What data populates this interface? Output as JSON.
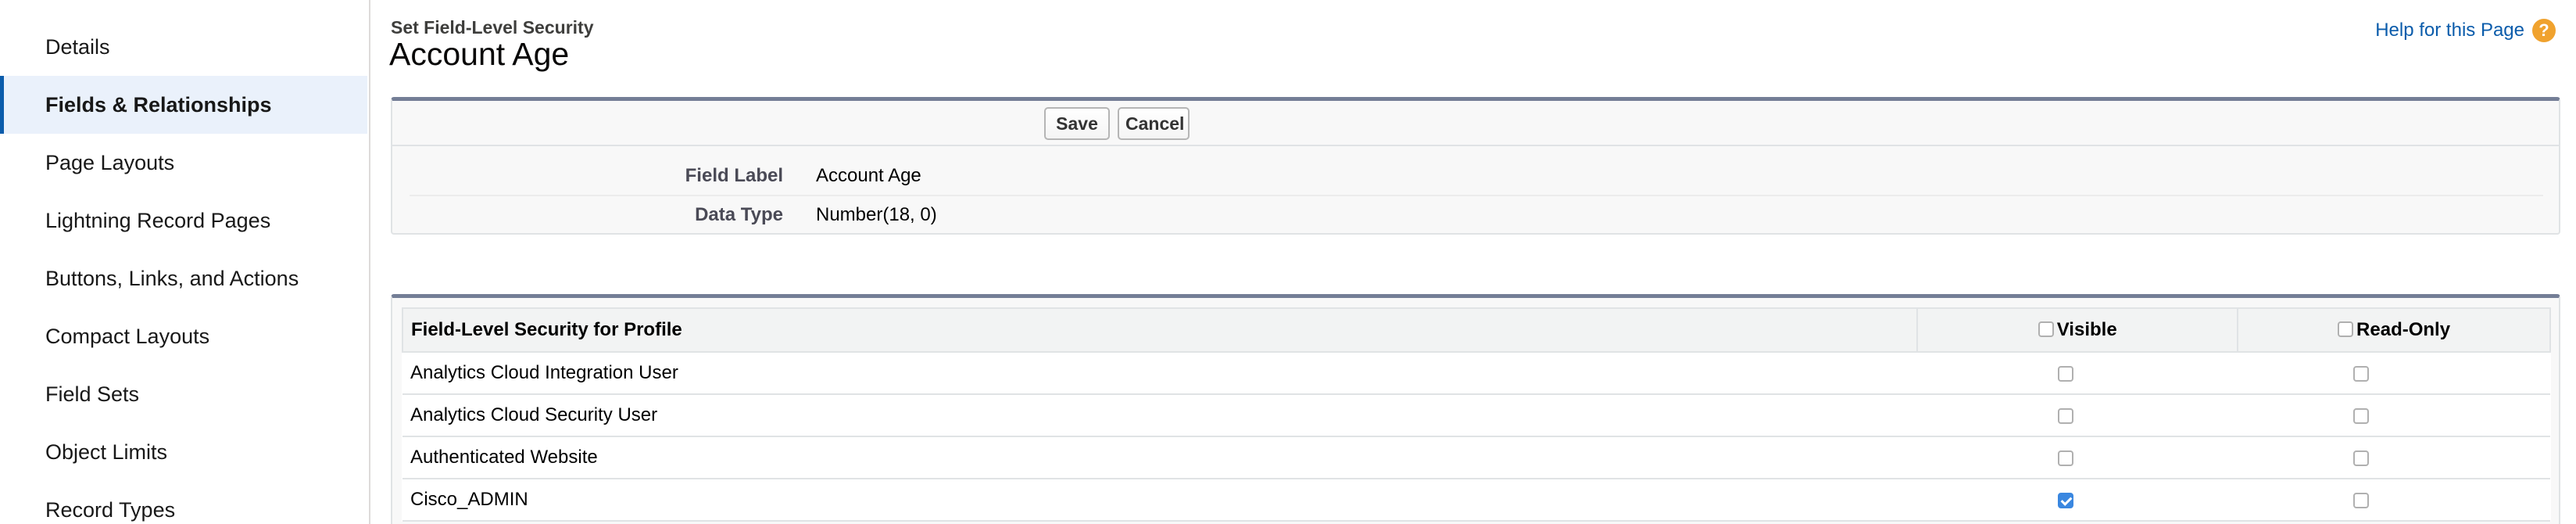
{
  "sidebar": {
    "items": [
      {
        "label": "Details",
        "active": false
      },
      {
        "label": "Fields & Relationships",
        "active": true
      },
      {
        "label": "Page Layouts",
        "active": false
      },
      {
        "label": "Lightning Record Pages",
        "active": false
      },
      {
        "label": "Buttons, Links, and Actions",
        "active": false
      },
      {
        "label": "Compact Layouts",
        "active": false
      },
      {
        "label": "Field Sets",
        "active": false
      },
      {
        "label": "Object Limits",
        "active": false
      },
      {
        "label": "Record Types",
        "active": false
      }
    ]
  },
  "header": {
    "breadcrumb": "Set Field-Level Security",
    "title": "Account Age",
    "help_link": "Help for this Page",
    "help_icon": "question-icon"
  },
  "actions": {
    "save_label": "Save",
    "cancel_label": "Cancel"
  },
  "field_info": {
    "label_caption": "Field Label",
    "label_value": "Account Age",
    "type_caption": "Data Type",
    "type_value": "Number(18, 0)"
  },
  "fls_table": {
    "columns": {
      "profile": "Field-Level Security for Profile",
      "visible": "Visible",
      "read_only": "Read-Only"
    },
    "rows": [
      {
        "profile": "Analytics Cloud Integration User",
        "visible": false,
        "read_only": false
      },
      {
        "profile": "Analytics Cloud Security User",
        "visible": false,
        "read_only": false
      },
      {
        "profile": "Authenticated Website",
        "visible": false,
        "read_only": false
      },
      {
        "profile": "Cisco_ADMIN",
        "visible": true,
        "read_only": false
      }
    ]
  },
  "colors": {
    "accent": "#0b5cab",
    "active_bg": "#eaf1fb",
    "checkbox_checked": "#3a87e0",
    "help_icon": "#f0a22e",
    "block_top_border": "#747e96"
  }
}
